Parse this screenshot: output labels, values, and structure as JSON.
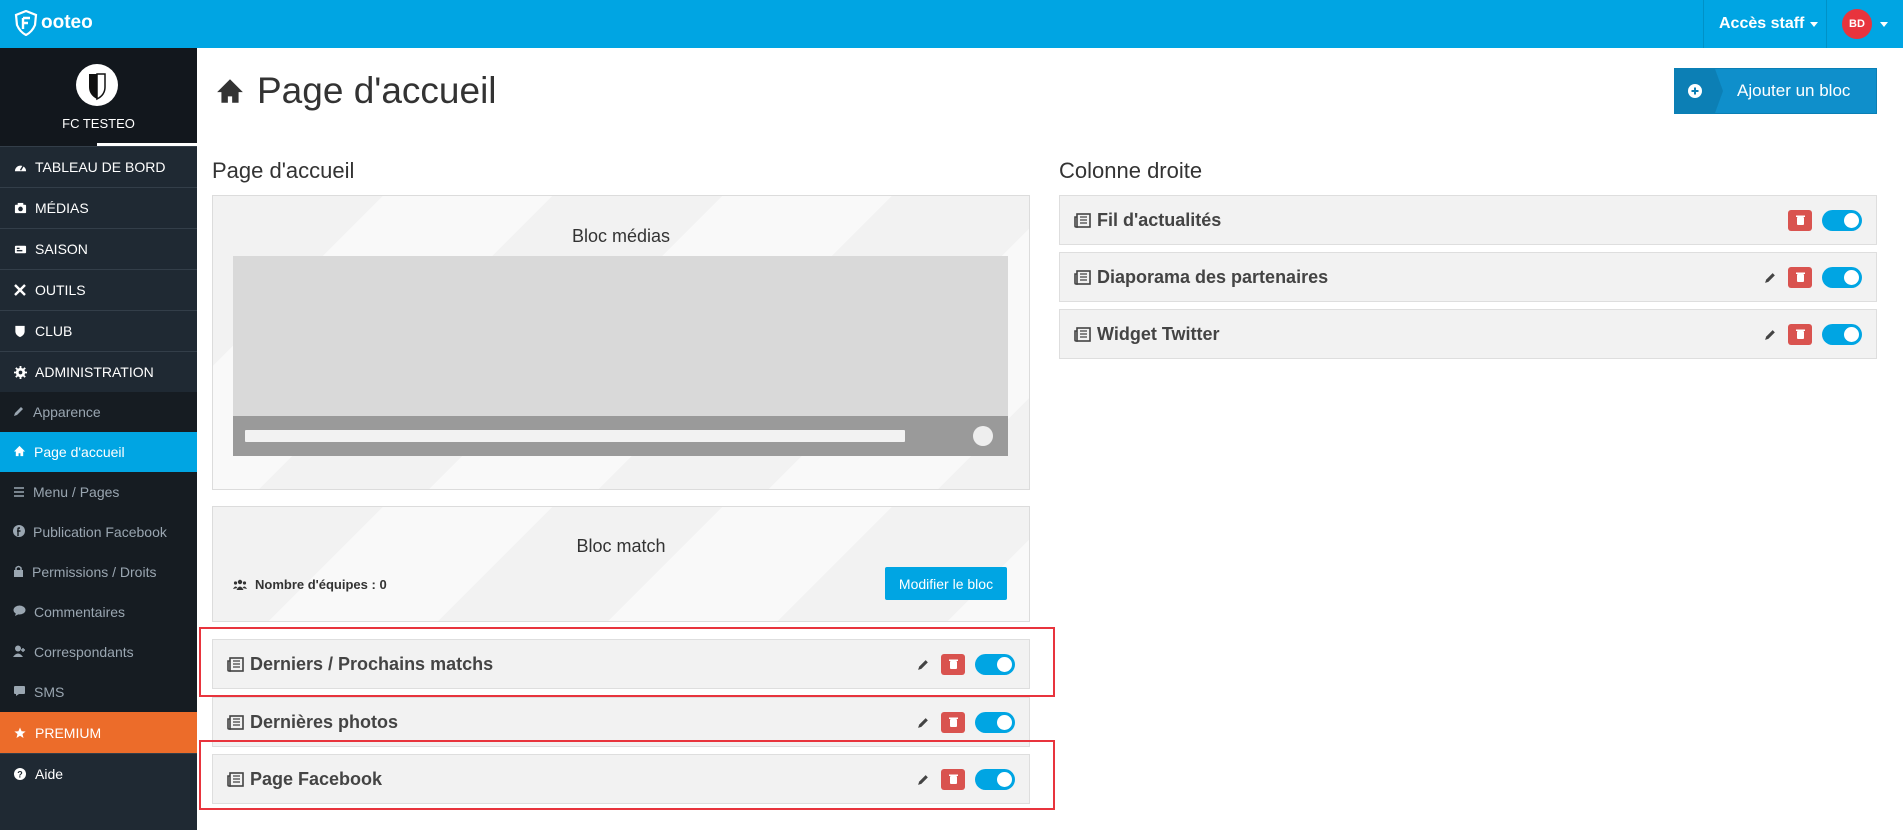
{
  "topbar": {
    "logo_text": "ooteo",
    "staff_label": "Accès staff",
    "user_initials": "BD"
  },
  "sidebar": {
    "club_name": "FC TESTEO",
    "items": [
      {
        "label": "TABLEAU DE BORD",
        "icon": "dashboard-icon"
      },
      {
        "label": "MÉDIAS",
        "icon": "media-icon"
      },
      {
        "label": "SAISON",
        "icon": "season-icon"
      },
      {
        "label": "OUTILS",
        "icon": "tools-icon"
      },
      {
        "label": "CLUB",
        "icon": "shield-icon"
      },
      {
        "label": "ADMINISTRATION",
        "icon": "gear-icon"
      }
    ],
    "sub_items": [
      {
        "label": "Apparence",
        "icon": "pencil-icon"
      },
      {
        "label": "Page d'accueil",
        "icon": "home-icon"
      },
      {
        "label": "Menu / Pages",
        "icon": "list-icon"
      },
      {
        "label": "Publication Facebook",
        "icon": "facebook-icon"
      },
      {
        "label": "Permissions / Droits",
        "icon": "lock-icon"
      },
      {
        "label": "Commentaires",
        "icon": "comment-icon"
      },
      {
        "label": "Correspondants",
        "icon": "user-icon"
      },
      {
        "label": "SMS",
        "icon": "sms-icon"
      }
    ],
    "premium_label": "PREMIUM",
    "help_label": "Aide"
  },
  "main": {
    "title": "Page d'accueil",
    "add_block_label": "Ajouter un bloc",
    "left_column_title": "Page d'accueil",
    "right_column_title": "Colonne droite",
    "media_block_title": "Bloc médias",
    "match_block_title": "Bloc match",
    "teams_count_label": "Nombre d'équipes : 0",
    "modify_block_label": "Modifier le bloc",
    "left_rows": [
      {
        "label": "Derniers / Prochains matchs"
      },
      {
        "label": "Dernières photos"
      },
      {
        "label": "Page Facebook"
      }
    ],
    "right_rows": [
      {
        "label": "Fil d'actualités"
      },
      {
        "label": "Diaporama des partenaires"
      },
      {
        "label": "Widget Twitter"
      }
    ]
  },
  "colors": {
    "brand_blue": "#00a5e3",
    "sidebar_dark": "#1f2933",
    "premium_orange": "#ec6c2a",
    "delete_red": "#d9534f",
    "highlight_red": "#e8343d"
  }
}
